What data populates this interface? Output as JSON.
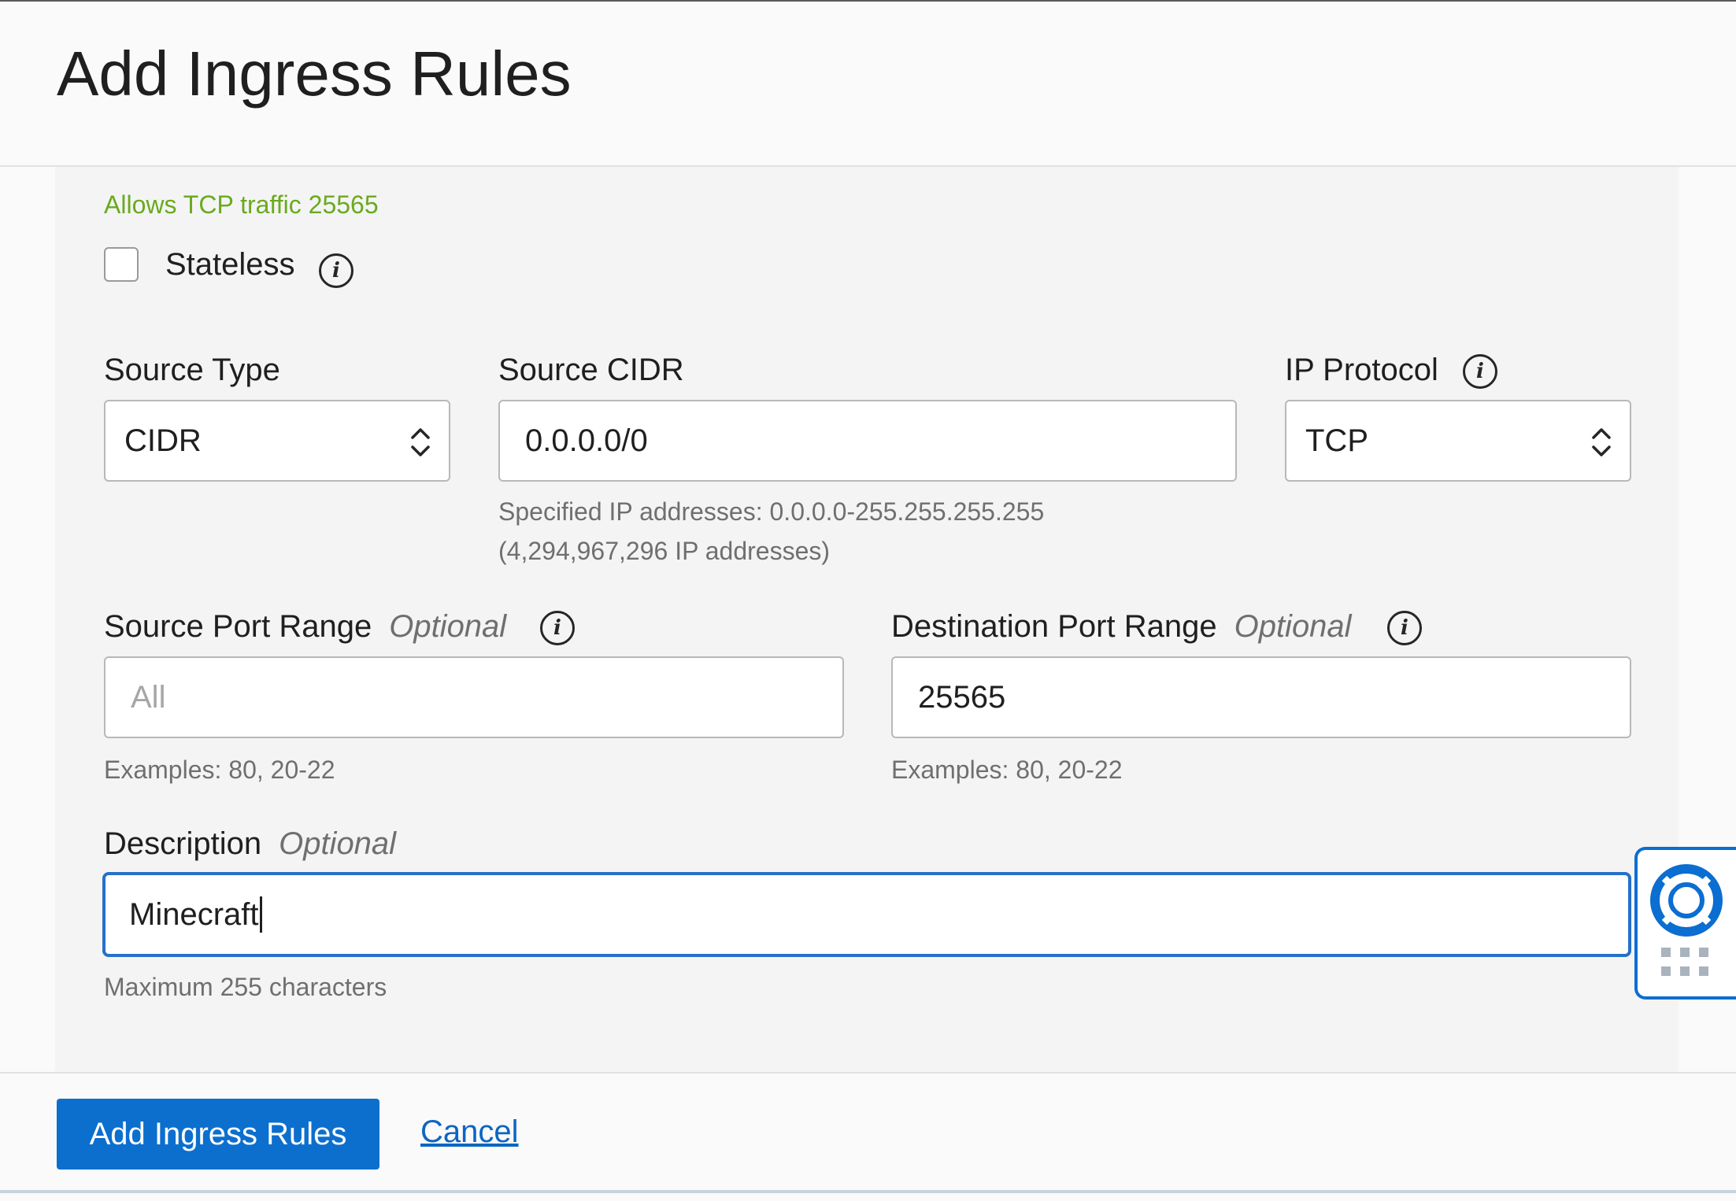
{
  "dialog": {
    "title": "Add Ingress Rules"
  },
  "rule": {
    "status_message": "Allows TCP traffic 25565",
    "stateless": {
      "label": "Stateless",
      "checked": false
    },
    "source_type": {
      "label": "Source Type",
      "value": "CIDR"
    },
    "source_cidr": {
      "label": "Source CIDR",
      "value": "0.0.0.0/0",
      "help_line1": "Specified IP addresses: 0.0.0.0-255.255.255.255",
      "help_line2": "(4,294,967,296 IP addresses)"
    },
    "ip_protocol": {
      "label": "IP Protocol",
      "value": "TCP"
    },
    "source_port_range": {
      "label": "Source Port Range",
      "optional": "Optional",
      "placeholder": "All",
      "help": "Examples: 80, 20-22"
    },
    "destination_port_range": {
      "label": "Destination Port Range",
      "optional": "Optional",
      "value": "25565",
      "help": "Examples: 80, 20-22"
    },
    "description": {
      "label": "Description",
      "optional": "Optional",
      "value": "Minecraft",
      "help": "Maximum 255 characters"
    }
  },
  "footer": {
    "submit_label": "Add Ingress Rules",
    "cancel_label": "Cancel"
  },
  "help_widget": {
    "icon": "lifebuoy-icon",
    "handle_icon": "grip-icon"
  },
  "colors": {
    "primary": "#0c6fce",
    "link": "#0b66c3",
    "success_text": "#6aaa1e",
    "focus_border": "#2670c9"
  }
}
